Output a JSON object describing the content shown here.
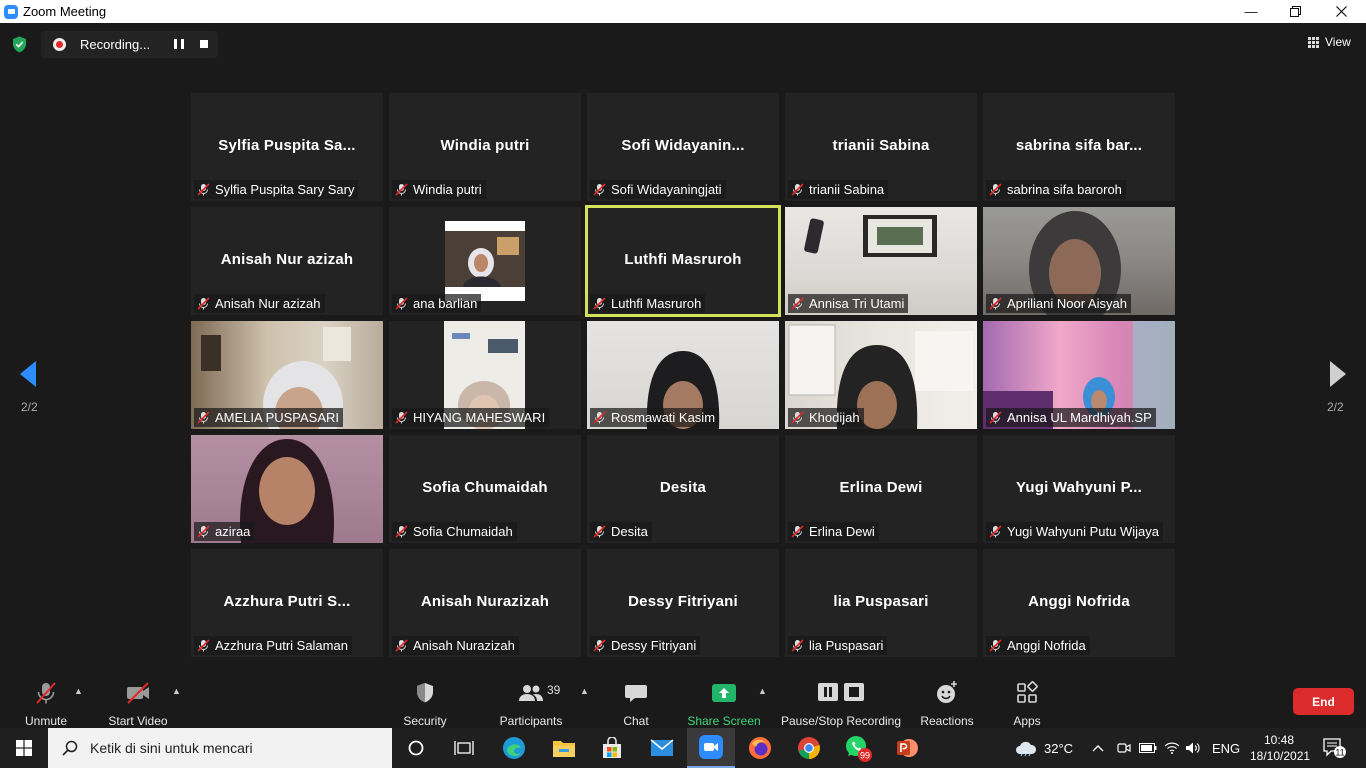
{
  "titlebar": {
    "title": "Zoom Meeting",
    "minimize_icon": "minimize-icon",
    "restore_icon": "restore-icon",
    "close_icon": "close-icon"
  },
  "topbar": {
    "recording_label": "Recording...",
    "view_label": "View"
  },
  "navigation": {
    "prev_page": "2/2",
    "next_page": "2/2"
  },
  "participants_grid": [
    {
      "display": "Sylfia  Puspita  Sa...",
      "name": "Sylfia Puspita Sary Sary",
      "video": false
    },
    {
      "display": "Windia putri",
      "name": "Windia putri",
      "video": false
    },
    {
      "display": "Sofi  Widayanin...",
      "name": "Sofi Widayaningjati",
      "video": false
    },
    {
      "display": "trianii Sabina",
      "name": "trianii Sabina",
      "video": false
    },
    {
      "display": "sabrina  sifa  bar...",
      "name": "sabrina sifa baroroh",
      "video": false
    },
    {
      "display": "Anisah Nur azizah",
      "name": "Anisah Nur azizah",
      "video": false
    },
    {
      "display": "",
      "name": "ana barlian",
      "video": true
    },
    {
      "display": "Luthfi Masruroh",
      "name": "Luthfi Masruroh",
      "video": false,
      "active_speaker": true
    },
    {
      "display": "",
      "name": "Annisa Tri Utami",
      "video": true
    },
    {
      "display": "",
      "name": "Apriliani Noor Aisyah",
      "video": true
    },
    {
      "display": "",
      "name": "AMELIA PUSPASARI",
      "video": true
    },
    {
      "display": "",
      "name": "HIYANG MAHESWARI",
      "video": true
    },
    {
      "display": "",
      "name": "Rosmawati Kasim",
      "video": true
    },
    {
      "display": "",
      "name": "Khodijah",
      "video": true
    },
    {
      "display": "",
      "name": "Annisa UL Mardhiyah.SP",
      "video": true
    },
    {
      "display": "",
      "name": "aziraa",
      "video": true
    },
    {
      "display": "Sofia Chumaidah",
      "name": "Sofia Chumaidah",
      "video": false
    },
    {
      "display": "Desita",
      "name": "Desita",
      "video": false
    },
    {
      "display": "Erlina Dewi",
      "name": "Erlina Dewi",
      "video": false
    },
    {
      "display": "Yugi  Wahyuni  P...",
      "name": "Yugi Wahyuni Putu Wijaya",
      "video": false
    },
    {
      "display": "Azzhura  Putri  S...",
      "name": "Azzhura Putri Salaman",
      "video": false
    },
    {
      "display": "Anisah Nurazizah",
      "name": "Anisah Nurazizah",
      "video": false
    },
    {
      "display": "Dessy Fitriyani",
      "name": "Dessy Fitriyani",
      "video": false
    },
    {
      "display": "lia Puspasari",
      "name": "lia Puspasari",
      "video": false
    },
    {
      "display": "Anggi Nofrida",
      "name": "Anggi Nofrida",
      "video": false
    }
  ],
  "toolbar": {
    "unmute": "Unmute",
    "start_video": "Start Video",
    "security": "Security",
    "participants": "Participants",
    "participants_count": "39",
    "chat": "Chat",
    "share_screen": "Share Screen",
    "recording": "Pause/Stop Recording",
    "reactions": "Reactions",
    "apps": "Apps",
    "end": "End"
  },
  "taskbar": {
    "search_placeholder": "Ketik di sini untuk mencari",
    "whatsapp_badge": "99",
    "weather": "32°C",
    "language": "ENG",
    "time": "10:48",
    "date": "18/10/2021",
    "notification_count": "11"
  },
  "colors": {
    "accent": "#2d8cff",
    "end": "#dc2b2b",
    "share": "#3ed77a",
    "active_speaker": "#d4e25a"
  }
}
